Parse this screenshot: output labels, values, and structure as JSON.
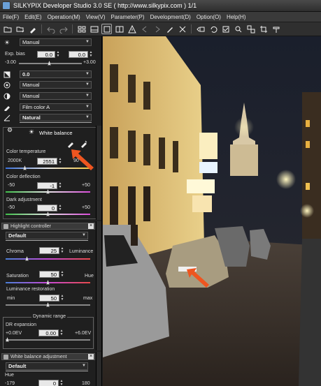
{
  "window": {
    "title": "SILKYPIX Developer Studio 3.0 SE ( http://www.silkypix.com )   1/1"
  },
  "menu": [
    "File(F)",
    "Edit(E)",
    "Operation(M)",
    "View(V)",
    "Parameter(P)",
    "Development(D)",
    "Option(O)",
    "Help(H)"
  ],
  "toolbar_icons": [
    "folder-open-icon",
    "folder-dropdown-icon",
    "dropper-icon",
    "undo-icon",
    "redo-icon",
    "grid-view-icon",
    "split-view-icon",
    "single-view-icon",
    "compare-view-icon",
    "warning-icon",
    "back-icon",
    "forward-icon",
    "brush-icon",
    "tools-icon",
    "develop-icon",
    "rotate-left-icon",
    "rotate-right-icon",
    "checkbox-icon",
    "select-icon",
    "select-all-icon",
    "crop-icon",
    "hammer-icon"
  ],
  "exposure": {
    "mode": "Manual",
    "label": "Exp. bias",
    "value1": "0.0",
    "value2": "0.0",
    "min": "-3.00",
    "max": "+3.00"
  },
  "contrast": {
    "value": "0.0"
  },
  "sharpness": {
    "mode": "Manual"
  },
  "noise": {
    "mode": "Manual"
  },
  "film": {
    "mode": "Film color A"
  },
  "tone": {
    "mode": "Natural"
  },
  "white_balance": {
    "title": "White balance",
    "temp_label": "Color temperature",
    "temp_min": "2000K",
    "temp_value": "2551",
    "temp_max": "90",
    "defl_label": "Color deflection",
    "defl_min": "-50",
    "defl_value": "-1",
    "defl_max": "+50",
    "dark_label": "Dark adjustment",
    "dark_min": "-50",
    "dark_value": "0",
    "dark_max": "+50"
  },
  "highlight": {
    "title": "Highlight controller",
    "preset": "Default",
    "chroma_label": "Chroma",
    "chroma_value": "25",
    "luminance_label": "Luminance",
    "saturation_label": "Saturation",
    "saturation_value": "50",
    "hue_label": "Hue",
    "restore_label": "Luminance restoration",
    "restore_min": "min",
    "restore_value": "50",
    "restore_max": "max",
    "dr_group": "Dynamic range",
    "dr_label": "DR expansion",
    "dr_min": "+0.0EV",
    "dr_value": "0.00",
    "dr_max": "+6.0EV"
  },
  "wb_adjust": {
    "title": "White balance adjustment",
    "preset": "Default",
    "hue_label": "Hue",
    "hue_min": "-179",
    "hue_value": "0",
    "hue_max": "180"
  },
  "colors": {
    "accent_arrow": "#ee5520",
    "panel_bg": "#1f1f1f"
  }
}
